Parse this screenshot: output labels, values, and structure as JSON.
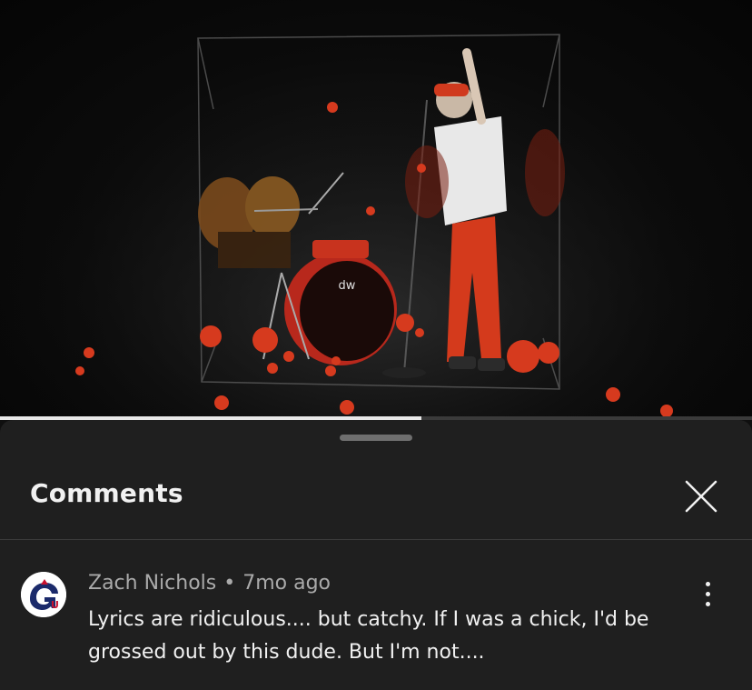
{
  "video": {
    "progress_fraction": 0.56,
    "drum_logo_text": "dw"
  },
  "comments_panel": {
    "title": "Comments",
    "close_icon": "close-icon"
  },
  "comments": [
    {
      "author": "Zach Nichols",
      "separator": "•",
      "time": "7mo ago",
      "text": "Lyrics are ridiculous.... but catchy. If I was a chick, I'd be grossed out by this dude. But I'm not....",
      "avatar_icon": "gu-logo-avatar",
      "menu_icon": "more-vert-icon"
    }
  ],
  "colors": {
    "sheet_bg": "#1f1f1f",
    "video_bg": "#0b0b0b",
    "accent_red": "#c8331e",
    "text_primary": "#f1f1f1",
    "text_secondary": "#aaaaaa"
  }
}
